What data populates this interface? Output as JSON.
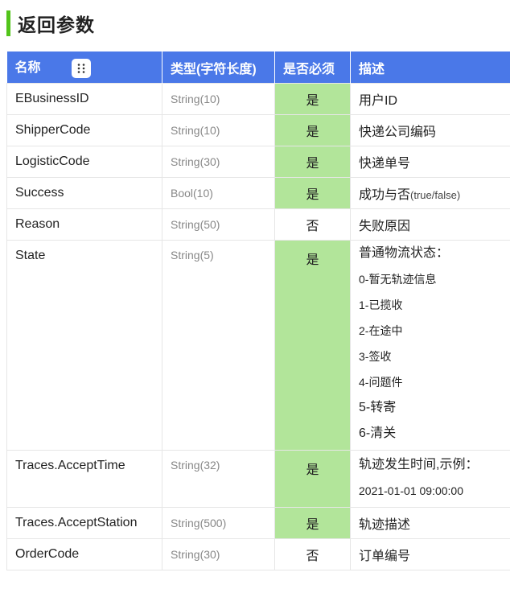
{
  "title": "返回参数",
  "columns": [
    "名称",
    "类型(字符长度)",
    "是否必须",
    "描述"
  ],
  "rows": [
    {
      "name": "EBusinessID",
      "type": "String(10)",
      "required": "是",
      "desc": "用户ID"
    },
    {
      "name": "ShipperCode",
      "type": "String(10)",
      "required": "是",
      "desc": "快递公司编码"
    },
    {
      "name": "LogisticCode",
      "type": "String(30)",
      "required": "是",
      "desc": "快递单号"
    },
    {
      "name": "Success",
      "type": "Bool(10)",
      "required": "是",
      "desc": "成功与否",
      "desc_suffix": "(true/false)"
    },
    {
      "name": "Reason",
      "type": "String(50)",
      "required": "否",
      "desc": "失败原因"
    },
    {
      "name": "State",
      "type": "String(5)",
      "required": "是",
      "desc_lines": [
        "普通物流状态：",
        "0-暂无轨迹信息",
        "1-已揽收",
        "2-在途中",
        "3-签收",
        "4-问题件",
        "5-转寄",
        "6-清关"
      ]
    },
    {
      "name": "Traces.AcceptTime",
      "type": "String(32)",
      "required": "是",
      "desc_lines": [
        "轨迹发生时间,示例：",
        "2021-01-01 09:00:00"
      ]
    },
    {
      "name": "Traces.AcceptStation",
      "type": "String(500)",
      "required": "是",
      "desc": "轨迹描述"
    },
    {
      "name": "OrderCode",
      "type": "String(30)",
      "required": "否",
      "desc": "订单编号"
    }
  ],
  "colors": {
    "header": "#4a78e8",
    "required_yes": "#b2e59a",
    "title_accent": "#52c41a"
  },
  "icons": {
    "column_grip": "drag-handle-icon"
  }
}
